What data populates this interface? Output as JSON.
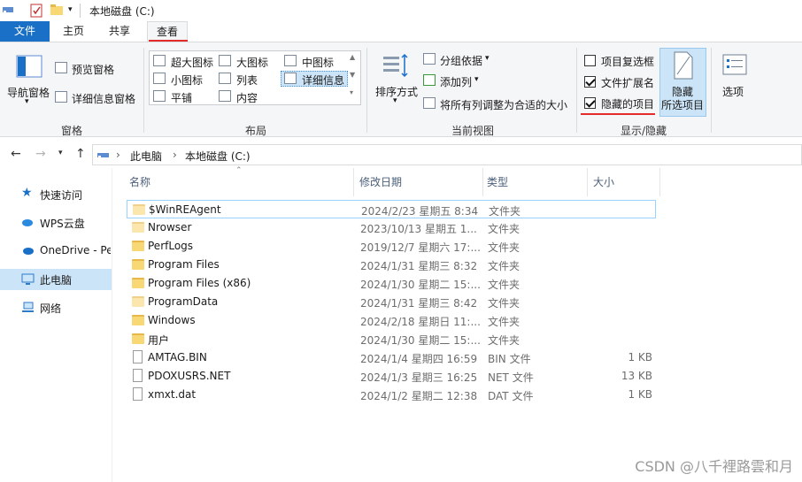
{
  "window": {
    "title": "本地磁盘 (C:)"
  },
  "tabs": {
    "file": "文件",
    "home": "主页",
    "share": "共享",
    "view": "查看"
  },
  "ribbon": {
    "panes": {
      "nav_pane": "导航窗格",
      "preview": "预览窗格",
      "details": "详细信息窗格",
      "group_label": "窗格"
    },
    "layout": {
      "extra_large": "超大图标",
      "large": "大图标",
      "medium": "中图标",
      "small": "小图标",
      "list": "列表",
      "details": "详细信息",
      "tiles": "平铺",
      "content": "内容",
      "group_label": "布局"
    },
    "current_view": {
      "sort": "排序方式",
      "group_by": "分组依据",
      "add_columns": "添加列",
      "fit_columns": "将所有列调整为合适的大小",
      "group_label": "当前视图"
    },
    "show_hide": {
      "item_checkboxes": "项目复选框",
      "item_checkboxes_checked": false,
      "file_extensions": "文件扩展名",
      "file_extensions_checked": true,
      "hidden_items": "隐藏的项目",
      "hidden_items_checked": true,
      "hide_selected_1": "隐藏",
      "hide_selected_2": "所选项目",
      "options": "选项",
      "group_label": "显示/隐藏"
    }
  },
  "address": {
    "crumbs": [
      "此电脑",
      "本地磁盘 (C:)"
    ]
  },
  "nav": {
    "items": [
      {
        "label": "快速访问"
      },
      {
        "label": "WPS云盘"
      },
      {
        "label": "OneDrive - Pe"
      },
      {
        "label": "此电脑"
      },
      {
        "label": "网络"
      }
    ]
  },
  "columns": {
    "name": "名称",
    "date": "修改日期",
    "type": "类型",
    "size": "大小"
  },
  "files": [
    {
      "name": "$WinREAgent",
      "date": "2024/2/23 星期五 8:34",
      "type": "文件夹",
      "size": ""
    },
    {
      "name": "Nrowser",
      "date": "2023/10/13 星期五 1...",
      "type": "文件夹",
      "size": ""
    },
    {
      "name": "PerfLogs",
      "date": "2019/12/7 星期六 17:...",
      "type": "文件夹",
      "size": ""
    },
    {
      "name": "Program Files",
      "date": "2024/1/31 星期三 8:32",
      "type": "文件夹",
      "size": ""
    },
    {
      "name": "Program Files (x86)",
      "date": "2024/1/30 星期二 15:...",
      "type": "文件夹",
      "size": ""
    },
    {
      "name": "ProgramData",
      "date": "2024/1/31 星期三 8:42",
      "type": "文件夹",
      "size": ""
    },
    {
      "name": "Windows",
      "date": "2024/2/18 星期日 11:...",
      "type": "文件夹",
      "size": ""
    },
    {
      "name": "用户",
      "date": "2024/1/30 星期二 15:...",
      "type": "文件夹",
      "size": ""
    },
    {
      "name": "AMTAG.BIN",
      "date": "2024/1/4 星期四 16:59",
      "type": "BIN 文件",
      "size": "1 KB"
    },
    {
      "name": "PDOXUSRS.NET",
      "date": "2024/1/3 星期三 16:25",
      "type": "NET 文件",
      "size": "13 KB"
    },
    {
      "name": "xmxt.dat",
      "date": "2024/1/2 星期二 12:38",
      "type": "DAT 文件",
      "size": "1 KB"
    }
  ],
  "watermark": "CSDN @八千裡路雲和月",
  "colors": {
    "accent": "#1a6fc6",
    "selection": "#cce4f7",
    "highlight": "#e32b2b",
    "folder": "#f8d775"
  }
}
